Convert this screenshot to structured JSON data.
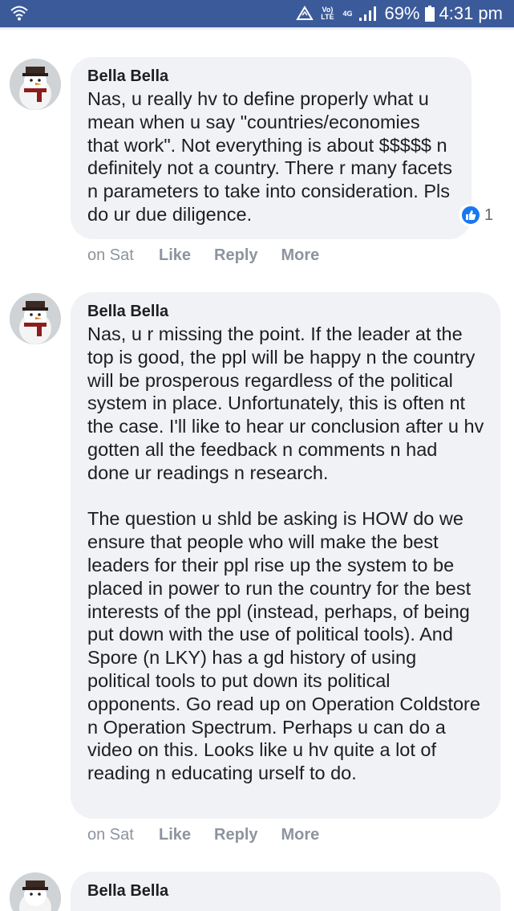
{
  "status_bar": {
    "network_small": "Vo) LTE",
    "network_type": "4G",
    "battery": "69%",
    "time": "4:31 pm"
  },
  "comments": [
    {
      "author": "Bella Bella",
      "text": "Nas, u really hv to define properly what u mean when u say \"countries/economies that work\". Not everything is about $$$$$ n definitely not a country. There r many facets n parameters to take into consideration. Pls do ur due diligence.",
      "reaction_count": "1",
      "time": "on Sat",
      "like_label": "Like",
      "reply_label": "Reply",
      "more_label": "More"
    },
    {
      "author": "Bella Bella",
      "text": "Nas, u r missing the point. If the leader at the top is good, the ppl will be happy n the country will be prosperous regardless of the political system in place. Unfortunately, this is often nt the case. I'll like to hear ur conclusion after u hv gotten all the feedback n comments n had done ur readings n research.\n\nThe question u shld be asking is HOW do we ensure that people who will make the best leaders for their ppl rise up the system to be placed in power to run the country for the best interests of the ppl (instead, perhaps, of being put down with the use of political tools). And Spore (n LKY) has a gd history of using political tools to put down its political opponents. Go read up on Operation Coldstore n Operation Spectrum. Perhaps u can do a video on this. Looks like u hv quite a lot of reading n educating urself to do.",
      "time": "on Sat",
      "like_label": "Like",
      "reply_label": "Reply",
      "more_label": "More"
    },
    {
      "author": "Bella Bella"
    }
  ]
}
